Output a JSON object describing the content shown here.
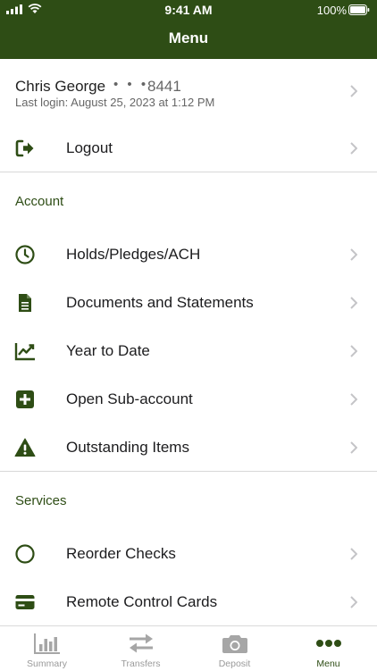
{
  "status": {
    "time": "9:41 AM",
    "battery": "100%"
  },
  "header": {
    "title": "Menu"
  },
  "profile": {
    "name": "Chris George",
    "mask": "• • •",
    "account_suffix": "8441",
    "last_login": "Last login: August 25, 2023 at 1:12 PM"
  },
  "logout": {
    "label": "Logout",
    "icon": "logout-icon"
  },
  "account": {
    "title": "Account",
    "items": [
      {
        "label": "Holds/Pledges/ACH",
        "icon": "clock-icon"
      },
      {
        "label": "Documents and Statements",
        "icon": "document-icon"
      },
      {
        "label": "Year to Date",
        "icon": "chart-icon"
      },
      {
        "label": "Open Sub-account",
        "icon": "plus-square-icon"
      },
      {
        "label": "Outstanding Items",
        "icon": "warning-icon"
      }
    ]
  },
  "services": {
    "title": "Services",
    "items": [
      {
        "label": "Reorder Checks",
        "icon": "circle-icon"
      },
      {
        "label": "Remote Control Cards",
        "icon": "card-icon"
      }
    ]
  },
  "tabs": [
    {
      "label": "Summary",
      "icon": "bar-chart-icon",
      "active": false
    },
    {
      "label": "Transfers",
      "icon": "transfer-icon",
      "active": false
    },
    {
      "label": "Deposit",
      "icon": "camera-icon",
      "active": false
    },
    {
      "label": "Menu",
      "icon": "more-icon",
      "active": true
    }
  ],
  "colors": {
    "brand": "#2e4d15",
    "chevron": "#c4c4c7",
    "tab_inactive": "#9a9a9a"
  }
}
